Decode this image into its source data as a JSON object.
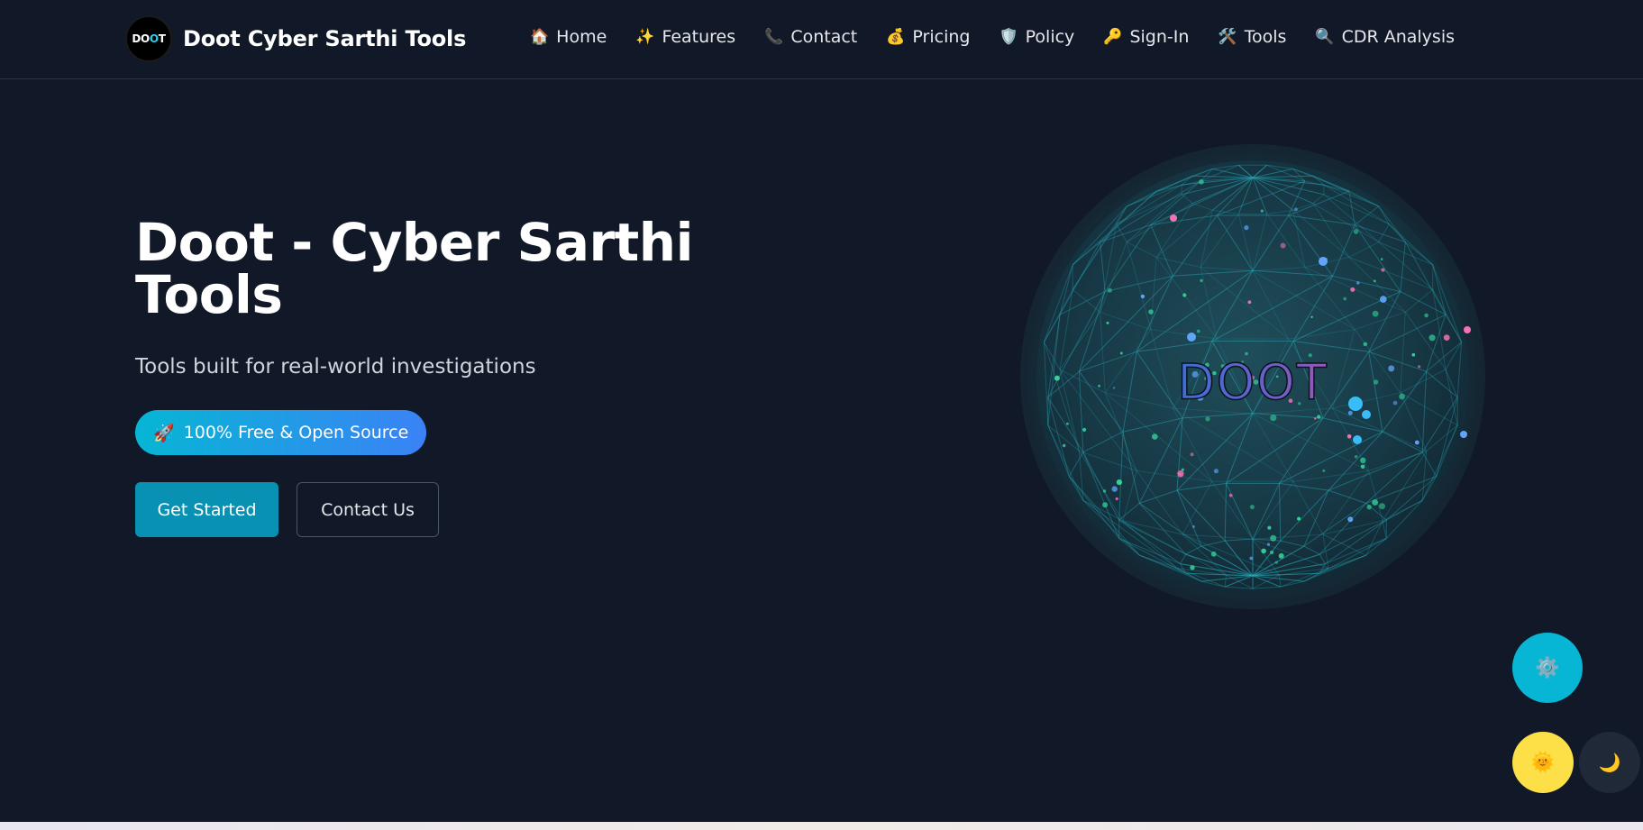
{
  "brand": {
    "logo_text_a": "DO",
    "logo_text_b": "O",
    "logo_text_c": "T",
    "name": "Doot Cyber Sarthi Tools"
  },
  "nav": {
    "items": [
      {
        "icon": "🏠",
        "icon_name": "home-icon",
        "label": "Home"
      },
      {
        "icon": "✨",
        "icon_name": "sparkles-icon",
        "label": "Features"
      },
      {
        "icon": "📞",
        "icon_name": "phone-icon",
        "label": "Contact"
      },
      {
        "icon": "💰",
        "icon_name": "money-bag-icon",
        "label": "Pricing"
      },
      {
        "icon": "🛡️",
        "icon_name": "shield-icon",
        "label": "Policy"
      },
      {
        "icon": "🔑",
        "icon_name": "key-icon",
        "label": "Sign-In"
      },
      {
        "icon": "🛠️",
        "icon_name": "tools-icon",
        "label": "Tools"
      },
      {
        "icon": "🔍",
        "icon_name": "magnifier-icon",
        "label": "CDR Analysis"
      }
    ]
  },
  "hero": {
    "title": "Doot - Cyber Sarthi Tools",
    "subtitle": "Tools built for real-world investigations",
    "badge_icon": "🚀",
    "badge_text": "100% Free & Open Source",
    "primary_button": "Get Started",
    "secondary_button": "Contact Us"
  },
  "globe": {
    "label": "DOOT"
  },
  "floating": {
    "settings_icon": "⚙️",
    "sun_icon": "🌞",
    "moon_icon": "🌙"
  },
  "colors": {
    "background": "#111827",
    "accent_cyan": "#06b6d4",
    "accent_blue": "#3b82f6",
    "primary_button": "#0891b2",
    "sun_button": "#fde047",
    "moon_button": "#1f2937"
  }
}
